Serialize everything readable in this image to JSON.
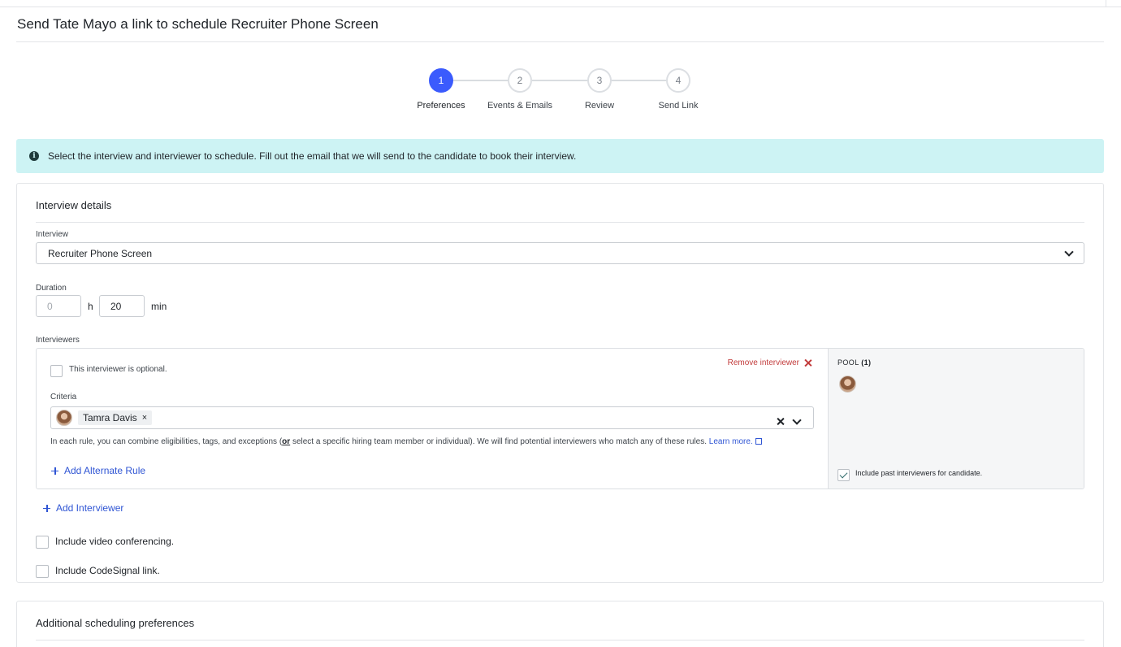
{
  "page": {
    "title": "Send Tate Mayo a link to schedule Recruiter Phone Screen"
  },
  "stepper": {
    "steps": [
      {
        "number": "1",
        "label": "Preferences",
        "state": "active"
      },
      {
        "number": "2",
        "label": "Events & Emails",
        "state": "inactive"
      },
      {
        "number": "3",
        "label": "Review",
        "state": "inactive"
      },
      {
        "number": "4",
        "label": "Send Link",
        "state": "inactive"
      }
    ]
  },
  "banner": {
    "icon": "info-icon",
    "text": "Select the interview and interviewer to schedule. Fill out the email that we will send to the candidate to book their interview."
  },
  "interview_details": {
    "title": "Interview details",
    "interview_label": "Interview",
    "interview_value": "Recruiter Phone Screen",
    "duration_label": "Duration",
    "hours_placeholder": "0",
    "hours_unit": "h",
    "minutes_value": "20",
    "minutes_unit": "min",
    "interviewers_label": "Interviewers",
    "interviewer": {
      "optional_label": "This interviewer is optional.",
      "optional_checked": false,
      "remove_label": "Remove interviewer",
      "criteria_label": "Criteria",
      "selected": "Tamra Davis",
      "chip_remove": "×",
      "helper_before": "In each rule, you can combine eligibilities, tags, and exceptions (",
      "helper_or": "or",
      "helper_after": " select a specific hiring team member or individual). We will find potential interviewers who match any of these rules. ",
      "learn_more": "Learn more.",
      "add_alternate_rule": "Add Alternate Rule",
      "pool_label": "POOL",
      "pool_count": "(1)",
      "include_past_label": "Include past interviewers for candidate.",
      "include_past_checked": true
    },
    "add_interviewer": "Add Interviewer",
    "video_conferencing_label": "Include video conferencing.",
    "video_conferencing_checked": false,
    "codesignal_label": "Include CodeSignal link.",
    "codesignal_checked": false
  },
  "additional": {
    "title": "Additional scheduling preferences"
  },
  "colors": {
    "accent": "#3b5bfd",
    "banner": "#cdf3f4",
    "danger": "#c23b3b",
    "link": "#2f55d4"
  }
}
